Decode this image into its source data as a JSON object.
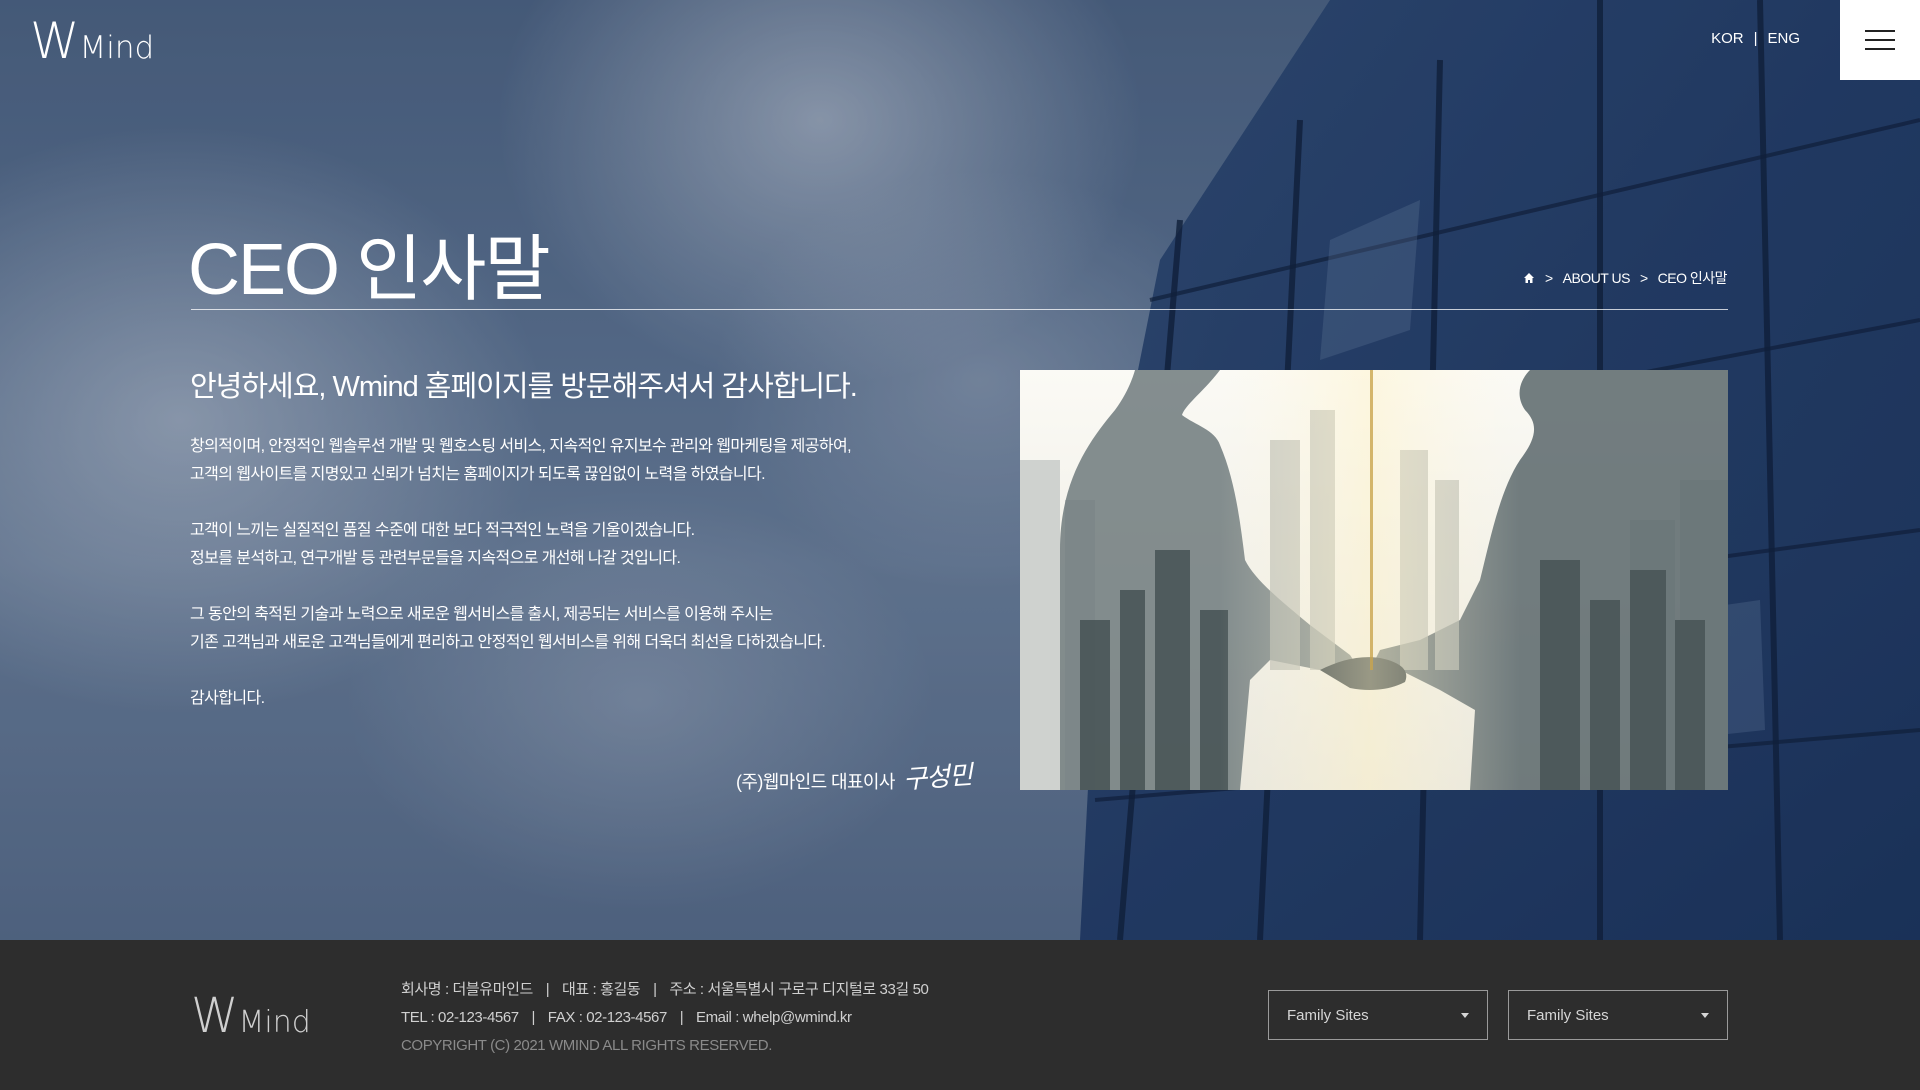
{
  "header": {
    "logo": {
      "w": "W",
      "mind": "Mind"
    },
    "lang": {
      "kor": "KOR",
      "sep": "|",
      "eng": "ENG"
    },
    "menu_icon": "hamburger-icon"
  },
  "page": {
    "title": "CEO 인사말",
    "breadcrumb": {
      "home_icon": "home-icon",
      "sep": ">",
      "level1": "ABOUT US",
      "level2": "CEO 인사말"
    }
  },
  "greeting": {
    "headline": "안녕하세요, Wmind 홈페이지를 방문해주셔서 감사합니다.",
    "paragraphs": [
      {
        "line1": "창의적이며, 안정적인 웹솔루션 개발 및 웹호스팅 서비스, 지속적인 유지보수 관리와 웹마케팅을 제공하여,",
        "line2": "고객의 웹사이트를 지명있고 신뢰가 넘치는 홈페이지가 되도록 끊임없이 노력을 하였습니다."
      },
      {
        "line1": "고객이 느끼는 실질적인 품질 수준에 대한 보다 적극적인 노력을 기울이겠습니다.",
        "line2": "정보를 분석하고, 연구개발 등 관련부문들을 지속적으로 개선해 나갈 것입니다."
      },
      {
        "line1": "그 동안의 축적된 기술과 노력으로 새로운 웹서비스를 출시, 제공되는 서비스를 이용해 주시는",
        "line2": "기존 고객님과 새로운 고객님들에게 편리하고 안정적인 웹서비스를 위해 더욱더 최선을 다하겠습니다."
      },
      {
        "line1": "감사합니다.",
        "line2": ""
      }
    ],
    "signature": {
      "text": "(주)웹마인드 대표이사",
      "name": "구성민"
    }
  },
  "footer": {
    "logo": {
      "w": "W",
      "mind": "Mind"
    },
    "company": "회사명 : 더블유마인드",
    "ceo": "대표 : 홍길동",
    "address": "주소 : 서울특별시 구로구 디지털로 33길 50",
    "tel": "TEL : 02-123-4567",
    "fax": "FAX : 02-123-4567",
    "email": "Email : whelp@wmind.kr",
    "sep": "|",
    "copyright": "COPYRIGHT (C) 2021 WMIND ALL RIGHTS RESERVED.",
    "family_sites": [
      {
        "label": "Family Sites"
      },
      {
        "label": "Family Sites"
      }
    ]
  },
  "colors": {
    "footer_bg": "#2d2d2d",
    "text_light": "#ffffff",
    "footer_text": "#d0d0d0",
    "copyright": "#8a8a8a"
  }
}
